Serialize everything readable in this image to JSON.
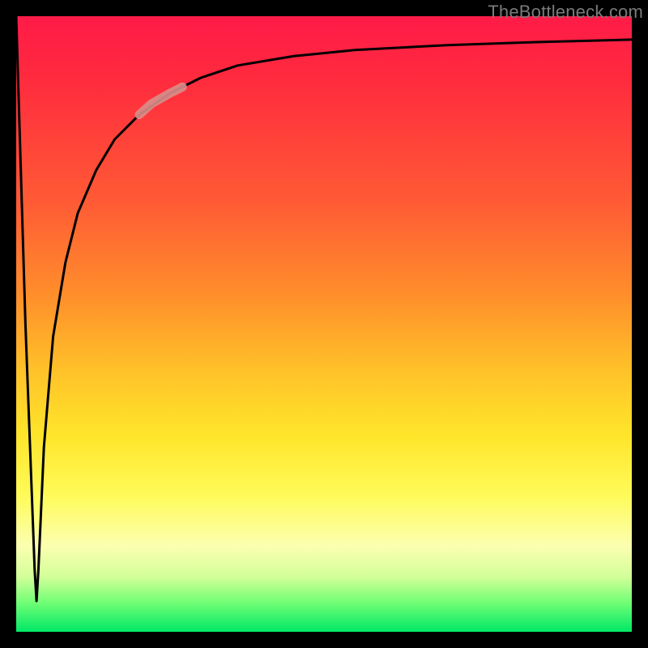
{
  "watermark": "TheBottleneck.com",
  "chart_data": {
    "type": "line",
    "title": "",
    "xlabel": "",
    "ylabel": "",
    "xlim": [
      0,
      100
    ],
    "ylim": [
      0,
      100
    ],
    "grid": false,
    "legend": false,
    "series": [
      {
        "name": "bottleneck-curve",
        "color": "#000000",
        "x": [
          0.0,
          1.5,
          3.0,
          3.3,
          3.6,
          4.5,
          6.0,
          8.0,
          10.0,
          13.0,
          16.0,
          20.0,
          25.0,
          30.0,
          36.0,
          45.0,
          55.0,
          70.0,
          85.0,
          100.0
        ],
        "values": [
          100,
          50,
          10,
          5,
          10,
          30,
          48,
          60,
          68,
          75,
          80,
          84,
          87.5,
          90,
          92,
          93.5,
          94.5,
          95.3,
          95.8,
          96.2
        ]
      }
    ],
    "highlight_segment": {
      "color": "#d98e8a",
      "x": [
        20.0,
        22.0,
        25.0,
        27.0
      ],
      "values": [
        84.0,
        85.8,
        87.5,
        88.5
      ]
    },
    "background_gradient": {
      "direction": "top-to-bottom",
      "stops": [
        {
          "pos": 0,
          "color": "#ff1b48"
        },
        {
          "pos": 50,
          "color": "#ffb12b"
        },
        {
          "pos": 78,
          "color": "#fffb5a"
        },
        {
          "pos": 100,
          "color": "#00e866"
        }
      ]
    }
  }
}
